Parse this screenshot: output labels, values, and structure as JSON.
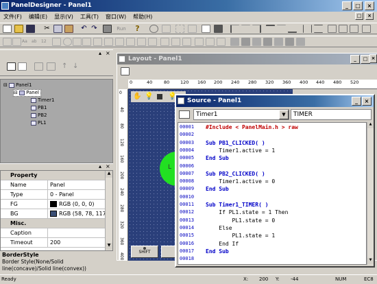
{
  "app": {
    "title": "PanelDesigner - Panel1"
  },
  "menu": [
    "文件(F)",
    "编辑(E)",
    "显示(V)",
    "工具(T)",
    "窗口(W)",
    "帮助(H)"
  ],
  "toolbar": {
    "run_label": "Run"
  },
  "tree": {
    "root": "Panel1",
    "panel": "Panel",
    "children": [
      "Timer1",
      "PB1",
      "PB2",
      "PL1"
    ]
  },
  "properties": {
    "header": "Property",
    "rows": [
      {
        "k": "Name",
        "v": "Panel"
      },
      {
        "k": "Type",
        "v": "0 - Panel"
      },
      {
        "k": "FG",
        "v": "RGB (0, 0, 0)",
        "color": "#000000"
      },
      {
        "k": "BG",
        "v": "RGB (58, 78, 117)",
        "color": "#3a4e75"
      }
    ],
    "misc_header": "Misc.",
    "misc_rows": [
      {
        "k": "Caption",
        "v": ""
      },
      {
        "k": "Timeout",
        "v": "200"
      }
    ],
    "desc_title": "BorderStyle",
    "desc_text1": "Border Style(None/Solid",
    "desc_text2": "line(concave)/Solid line(convex))"
  },
  "layout": {
    "title": "Layout - Panel1",
    "ruler": [
      "0",
      "40",
      "80",
      "120",
      "160",
      "200",
      "240",
      "280",
      "320",
      "360",
      "400",
      "440",
      "480",
      "520"
    ],
    "vruler": [
      "0",
      "40",
      "80",
      "120",
      "160",
      "200",
      "240",
      "280",
      "320",
      "360",
      "400"
    ],
    "shift_label": "SHIFT",
    "lamp_text": "L"
  },
  "source": {
    "title": "Source - Panel1",
    "object_select": "Timer1",
    "event_field": "TIMER",
    "lines": [
      {
        "n": "00001",
        "t": "#Include < PanelMain.h > raw",
        "c": "rd"
      },
      {
        "n": "00002",
        "t": "",
        "c": ""
      },
      {
        "n": "00003",
        "t": "Sub PB1_CLICKED( )",
        "c": "kw"
      },
      {
        "n": "00004",
        "t": "    Timer1.active = 1",
        "c": ""
      },
      {
        "n": "00005",
        "t": "End Sub",
        "c": "kw"
      },
      {
        "n": "00006",
        "t": "",
        "c": ""
      },
      {
        "n": "00007",
        "t": "Sub PB2_CLICKED( )",
        "c": "kw"
      },
      {
        "n": "00008",
        "t": "    Timer1.active = 0",
        "c": ""
      },
      {
        "n": "00009",
        "t": "End Sub",
        "c": "kw"
      },
      {
        "n": "00010",
        "t": "",
        "c": ""
      },
      {
        "n": "00011",
        "t": "Sub Timer1_TIMER( )",
        "c": "kw"
      },
      {
        "n": "00012",
        "t": "    If PL1.state = 1 Then",
        "c": ""
      },
      {
        "n": "00013",
        "t": "        PL1.state = 0",
        "c": ""
      },
      {
        "n": "00014",
        "t": "    Else",
        "c": ""
      },
      {
        "n": "00015",
        "t": "        PL1.state = 1",
        "c": ""
      },
      {
        "n": "00016",
        "t": "    End If",
        "c": ""
      },
      {
        "n": "00017",
        "t": "End Sub",
        "c": "kw"
      },
      {
        "n": "00018",
        "t": "",
        "c": ""
      }
    ]
  },
  "status": {
    "ready": "Ready",
    "x_label": "X:",
    "x_value": "200",
    "y_label": "Y:",
    "y_value": "-44",
    "num": "NUM",
    "ec": "EC8"
  }
}
